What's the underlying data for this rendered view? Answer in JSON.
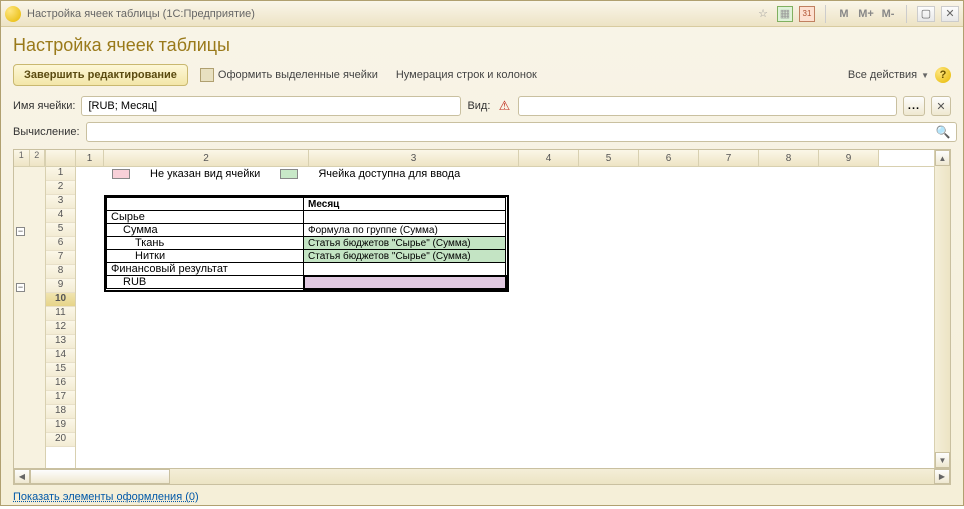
{
  "window": {
    "title": "Настройка ячеек таблицы  (1С:Предприятие)"
  },
  "header": {
    "title": "Настройка ячеек таблицы"
  },
  "toolbar": {
    "finish": "Завершить редактирование",
    "format": "Оформить выделенные ячейки",
    "numbering": "Нумерация строк и колонок",
    "all_actions": "Все действия"
  },
  "fields": {
    "cellname_label": "Имя ячейки:",
    "cellname_value": "[RUB; Месяц]",
    "vid_label": "Вид:",
    "vid_value": "",
    "calc_label": "Вычисление:",
    "calc_value": "",
    "dots": "..."
  },
  "legend": {
    "l1": "Не указан вид ячейки",
    "l2": "Ячейка доступна для ввода"
  },
  "cols": [
    "1",
    "2",
    "3",
    "4",
    "5",
    "6",
    "7",
    "8",
    "9"
  ],
  "rows": [
    "1",
    "2",
    "3",
    "4",
    "5",
    "6",
    "7",
    "8",
    "9",
    "10",
    "11",
    "12",
    "13",
    "14",
    "15",
    "16",
    "17",
    "18",
    "19",
    "20"
  ],
  "selected_row": "10",
  "datagrid": {
    "col_header": "Месяц",
    "r1": "Сырье",
    "r2": "Сумма",
    "r2v": "Формула по группе (Сумма)",
    "r3": "Ткань",
    "r3v": "Статья бюджетов \"Сырье\" (Сумма)",
    "r4": "Нитки",
    "r4v": "Статья бюджетов \"Сырье\" (Сумма)",
    "r5": "Финансовый результат",
    "r6": "RUB"
  },
  "footer": {
    "link": "Показать элементы оформления (0)"
  },
  "mem": {
    "m": "M",
    "mp": "M+",
    "mm": "M-"
  },
  "tree": {
    "n1": "1",
    "n2": "2"
  }
}
